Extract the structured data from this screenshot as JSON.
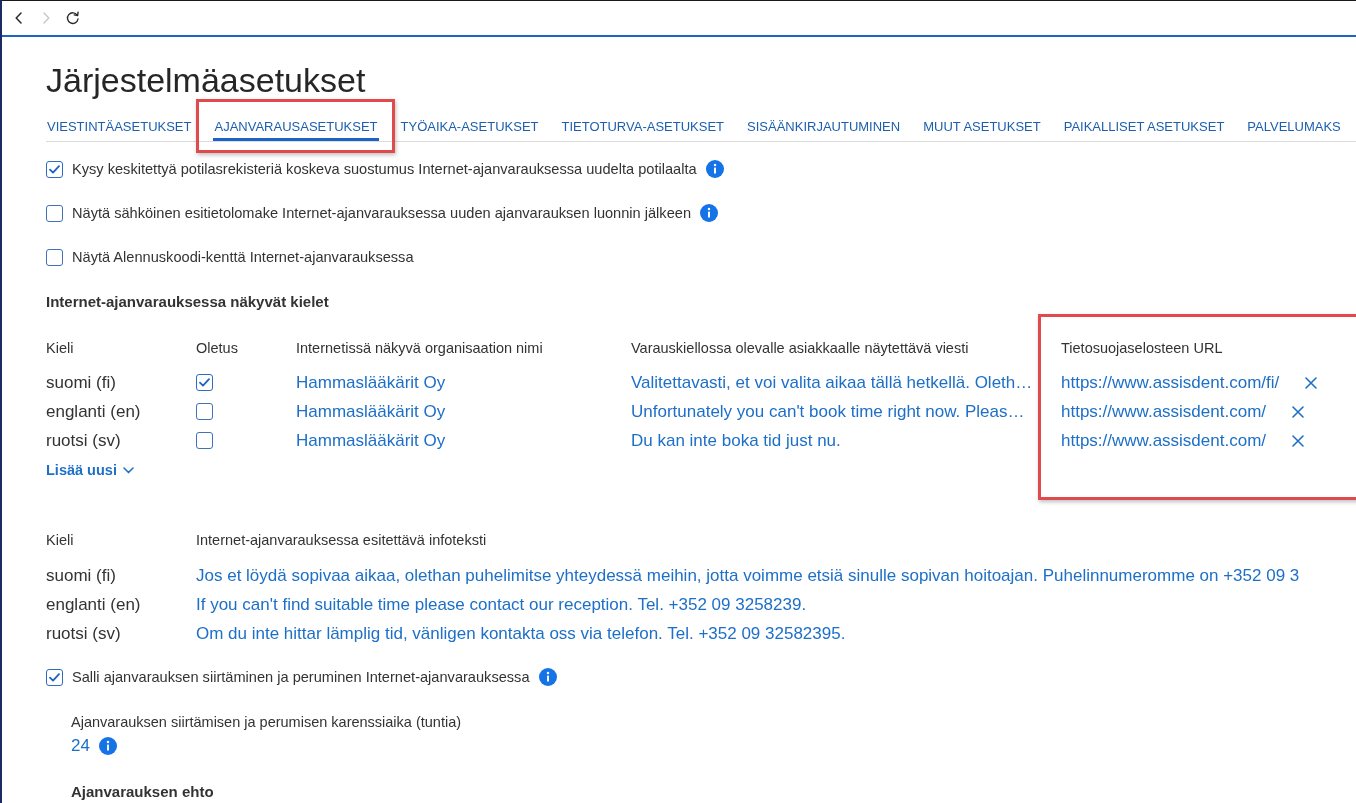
{
  "browser": {
    "nav_buttons": [
      {
        "kind": "back",
        "disabled": false
      },
      {
        "kind": "forward",
        "disabled": true
      },
      {
        "kind": "reload",
        "disabled": false
      }
    ]
  },
  "page": {
    "title": "Järjestelmäasetukset"
  },
  "tabs": [
    {
      "label": "VIESTINTÄASETUKSET",
      "selected": false,
      "highlighted": false
    },
    {
      "label": "AJANVARAUSASETUKSET",
      "selected": true,
      "highlighted": true
    },
    {
      "label": "TYÖAIKA-ASETUKSET",
      "selected": false,
      "highlighted": false
    },
    {
      "label": "TIETOTURVA-ASETUKSET",
      "selected": false,
      "highlighted": false
    },
    {
      "label": "SISÄÄNKIRJAUTUMINEN",
      "selected": false,
      "highlighted": false
    },
    {
      "label": "MUUT ASETUKSET",
      "selected": false,
      "highlighted": false
    },
    {
      "label": "PAIKALLISET ASETUKSET",
      "selected": false,
      "highlighted": false
    },
    {
      "label": "PALVELUMAKS",
      "selected": false,
      "highlighted": false
    }
  ],
  "options": [
    {
      "label": "Kysy keskitettyä potilasrekisteriä koskeva suostumus Internet-ajanvarauksessa uudelta potilaalta",
      "checked": true,
      "info": true
    },
    {
      "label": "Näytä sähköinen esitietolomake Internet-ajanvarauksessa uuden ajanvarauksen luonnin jälkeen",
      "checked": false,
      "info": true
    },
    {
      "label": "Näytä Alennuskoodi-kenttä Internet-ajanvarauksessa",
      "checked": false,
      "info": false
    }
  ],
  "languages": {
    "heading": "Internet-ajanvarauksessa näkyvät kielet",
    "columns": [
      {
        "label": "Kieli",
        "highlighted": false
      },
      {
        "label": "Oletus",
        "highlighted": false
      },
      {
        "label": "Internetissä näkyvä organisaation nimi",
        "highlighted": false
      },
      {
        "label": "Varauskiellossa olevalle asiakkaalle näytettävä viesti",
        "highlighted": false
      },
      {
        "label": "Tietosuojaselosteen URL",
        "highlighted": true
      }
    ],
    "rows": [
      {
        "language": "suomi (fi)",
        "default": true,
        "organization": "Hammaslääkärit Oy",
        "blocked_message": "Valitettavasti, et voi valita aikaa tällä hetkellä. Oleth…",
        "privacy_url": "https://www.assisdent.com/fi/"
      },
      {
        "language": "englanti (en)",
        "default": false,
        "organization": "Hammaslääkärit Oy",
        "blocked_message": "Unfortunately you can't book time right now. Pleas…",
        "privacy_url": "https://www.assisdent.com/"
      },
      {
        "language": "ruotsi (sv)",
        "default": false,
        "organization": "Hammaslääkärit Oy",
        "blocked_message": "Du kan inte boka tid just nu.",
        "privacy_url": "https://www.assisdent.com/"
      }
    ],
    "add_button": "Lisää uusi"
  },
  "info_texts": {
    "columns": [
      "Kieli",
      "Internet-ajanvarauksessa esitettävä infoteksti"
    ],
    "rows": [
      {
        "language": "suomi (fi)",
        "text": "Jos et löydä sopivaa aikaa, olethan puhelimitse yhteydessä meihin, jotta voimme etsiä sinulle sopivan hoitoajan. Puhelinnumeromme on +352 09 3"
      },
      {
        "language": "englanti (en)",
        "text": "If you can't find suitable time please contact our reception. Tel. +352 09 3258239."
      },
      {
        "language": "ruotsi (sv)",
        "text": "Om du inte hittar lämplig tid, vänligen kontakta oss via telefon. Tel. +352 09 32582395."
      }
    ]
  },
  "allow_rescheduling": {
    "label": "Salli ajanvarauksen siirtäminen ja peruminen Internet-ajanvarauksessa",
    "checked": true,
    "info": true
  },
  "grace_period": {
    "label": "Ajanvarauksen siirtämisen ja perumisen karenssiaika (tuntia)",
    "value": "24",
    "info": true
  },
  "condition": {
    "heading": "Ajanvarauksen ehto"
  }
}
